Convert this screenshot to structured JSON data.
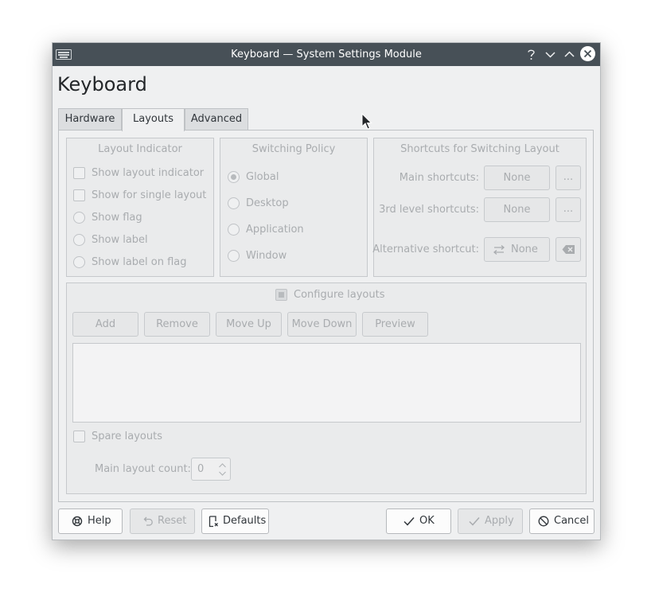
{
  "window": {
    "title": "Keyboard — System Settings Module"
  },
  "page_title": "Keyboard",
  "tabs": [
    {
      "label": "Hardware",
      "active": false
    },
    {
      "label": "Layouts",
      "active": true
    },
    {
      "label": "Advanced",
      "active": false
    }
  ],
  "layout_indicator": {
    "title": "Layout Indicator",
    "options": [
      {
        "label": "Show layout indicator",
        "type": "checkbox",
        "checked": false
      },
      {
        "label": "Show for single layout",
        "type": "checkbox",
        "checked": false
      },
      {
        "label": "Show flag",
        "type": "radio",
        "checked": false
      },
      {
        "label": "Show label",
        "type": "radio",
        "checked": false
      },
      {
        "label": "Show label on flag",
        "type": "radio",
        "checked": false
      }
    ]
  },
  "switching_policy": {
    "title": "Switching Policy",
    "options": [
      {
        "label": "Global",
        "checked": true
      },
      {
        "label": "Desktop",
        "checked": false
      },
      {
        "label": "Application",
        "checked": false
      },
      {
        "label": "Window",
        "checked": false
      }
    ]
  },
  "shortcuts": {
    "title": "Shortcuts for Switching Layout",
    "main_label": "Main shortcuts:",
    "main_value": "None",
    "third_label": "3rd level shortcuts:",
    "third_value": "None",
    "alt_label": "Alternative shortcut:",
    "alt_value": "None",
    "more_label": "..."
  },
  "configure": {
    "label": "Configure layouts",
    "checked": true,
    "buttons": [
      "Add",
      "Remove",
      "Move Up",
      "Move Down",
      "Preview"
    ]
  },
  "spare": {
    "label": "Spare layouts",
    "count_label": "Main layout count:",
    "count_value": "0"
  },
  "footer": {
    "help": "Help",
    "reset": "Reset",
    "defaults": "Defaults",
    "ok": "OK",
    "apply": "Apply",
    "cancel": "Cancel"
  },
  "colors": {
    "titlebar": "#475057",
    "window_bg": "#eff0f1",
    "disabled_text": "#a9acaf",
    "text": "#31363b"
  }
}
